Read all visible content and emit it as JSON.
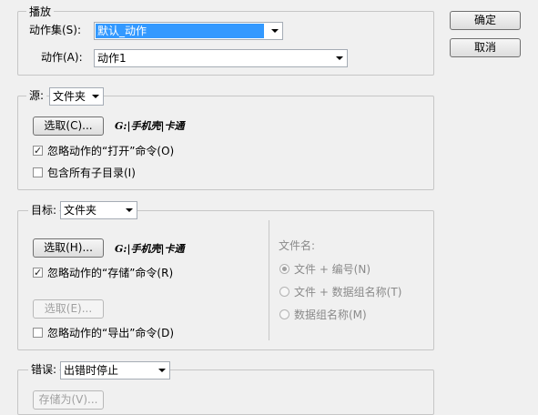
{
  "dialog": {
    "ok_label": "确定",
    "cancel_label": "取消"
  },
  "play": {
    "legend": "播放",
    "set_label": "动作集(S):",
    "set_value": "默认_动作",
    "action_label": "动作(A):",
    "action_value": "动作1"
  },
  "source": {
    "legend": "源:",
    "type_value": "文件夹",
    "choose_label": "选取(C)...",
    "path": "G:|手机壳|卡通",
    "override_open_label": "忽略动作的“打开”命令(O)",
    "override_open_checked": true,
    "include_subfolders_label": "包含所有子目录(I)",
    "include_subfolders_checked": false
  },
  "destination": {
    "legend": "目标:",
    "type_value": "文件夹",
    "choose_label": "选取(H)...",
    "path": "G:|手机壳|卡通",
    "override_save_label": "忽略动作的“存储”命令(R)",
    "override_save_checked": true,
    "choose_e_label": "选取(E)...",
    "override_export_label": "忽略动作的“导出”命令(D)",
    "override_export_checked": false,
    "filename_label": "文件名:",
    "radio_options": [
      {
        "label": "文件 + 编号(N)",
        "checked": true
      },
      {
        "label": "文件 + 数据组名称(T)",
        "checked": false
      },
      {
        "label": "数据组名称(M)",
        "checked": false
      }
    ]
  },
  "errors": {
    "legend": "错误:",
    "value": "出错时停止",
    "save_as_label": "存储为(V)..."
  }
}
